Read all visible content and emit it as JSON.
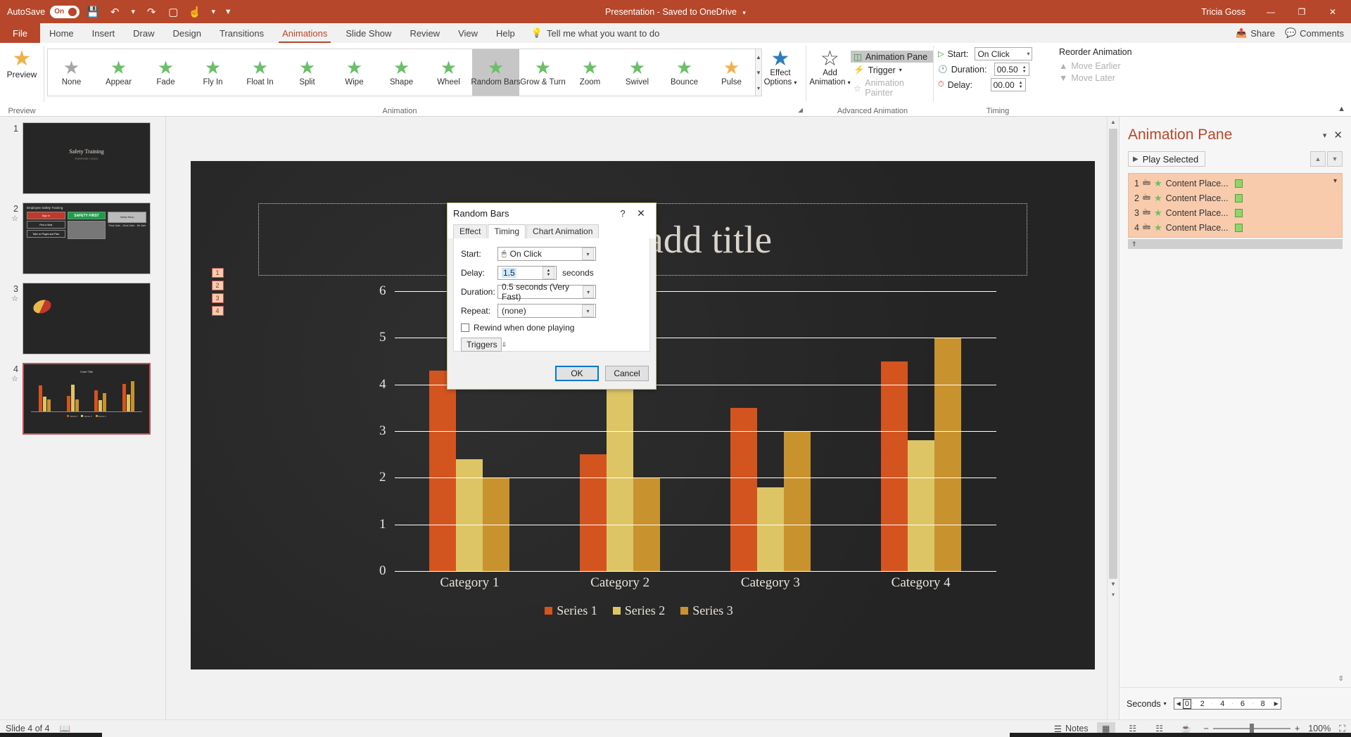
{
  "titlebar": {
    "autosave_label": "AutoSave",
    "autosave_state": "On",
    "icons": [
      "save-icon",
      "undo-icon",
      "redo-icon",
      "start-from-beginning-icon",
      "touch-mode-icon",
      "customize-toolbar-icon"
    ],
    "document_title": "Presentation  -  Saved to OneDrive",
    "user": "Tricia Goss",
    "minimize": "—",
    "restore": "❐",
    "close": "✕"
  },
  "ribbon_tabs": {
    "file": "File",
    "items": [
      "Home",
      "Insert",
      "Draw",
      "Design",
      "Transitions",
      "Animations",
      "Slide Show",
      "Review",
      "View",
      "Help"
    ],
    "active": "Animations",
    "tellme": "Tell me what you want to do",
    "share": "Share",
    "comments": "Comments"
  },
  "ribbon": {
    "preview": {
      "label": "Preview",
      "group": "Preview"
    },
    "animation": {
      "group": "Animation",
      "items": [
        {
          "label": "None",
          "selected": false,
          "color": "#a6a6a6"
        },
        {
          "label": "Appear",
          "selected": false,
          "color": "#6abf69"
        },
        {
          "label": "Fade",
          "selected": false,
          "color": "#6abf69"
        },
        {
          "label": "Fly In",
          "selected": false,
          "color": "#6abf69"
        },
        {
          "label": "Float In",
          "selected": false,
          "color": "#6abf69"
        },
        {
          "label": "Split",
          "selected": false,
          "color": "#6abf69"
        },
        {
          "label": "Wipe",
          "selected": false,
          "color": "#6abf69"
        },
        {
          "label": "Shape",
          "selected": false,
          "color": "#6abf69"
        },
        {
          "label": "Wheel",
          "selected": false,
          "color": "#6abf69"
        },
        {
          "label": "Random Bars",
          "selected": true,
          "color": "#6abf69"
        },
        {
          "label": "Grow & Turn",
          "selected": false,
          "color": "#6abf69"
        },
        {
          "label": "Zoom",
          "selected": false,
          "color": "#6abf69"
        },
        {
          "label": "Swivel",
          "selected": false,
          "color": "#6abf69"
        },
        {
          "label": "Bounce",
          "selected": false,
          "color": "#6abf69"
        },
        {
          "label": "Pulse",
          "selected": false,
          "color": "#f0b04a"
        }
      ]
    },
    "effect_options": {
      "line1": "Effect",
      "line2": "Options"
    },
    "advanced": {
      "group": "Advanced Animation",
      "add_animation_l1": "Add",
      "add_animation_l2": "Animation",
      "animation_pane": "Animation Pane",
      "trigger": "Trigger",
      "animation_painter": "Animation Painter"
    },
    "timing": {
      "group": "Timing",
      "start_label": "Start:",
      "start_value": "On Click",
      "duration_label": "Duration:",
      "duration_value": "00.50",
      "delay_label": "Delay:",
      "delay_value": "00.00",
      "reorder_title": "Reorder Animation",
      "move_earlier": "Move Earlier",
      "move_later": "Move Later"
    }
  },
  "thumbnails": [
    {
      "num": "1",
      "animated": false,
      "type": "title",
      "title": "Safety Training",
      "subtitle": "PURPOSE / ELEV"
    },
    {
      "num": "2",
      "animated": true,
      "type": "content",
      "header": "Employee Safety Training",
      "sign_in": "Sign In",
      "safety_first": "SAFETY FIRST",
      "find_exit": "Find a Seat",
      "take_pages": "Take on Pages and Plan",
      "caption1": "Safety Menu",
      "caption2": "Think Safe... Work Safe... Be Safe"
    },
    {
      "num": "3",
      "animated": true,
      "type": "shape"
    },
    {
      "num": "4",
      "animated": true,
      "type": "chart",
      "selected": true,
      "chart_title": "Chart Title"
    }
  ],
  "slide": {
    "title_placeholder": "Click to add title",
    "animation_tags": [
      "1",
      "2",
      "3",
      "4"
    ]
  },
  "chart_data": {
    "type": "bar",
    "title": "",
    "categories": [
      "Category 1",
      "Category 2",
      "Category 3",
      "Category 4"
    ],
    "series": [
      {
        "name": "Series 1",
        "color": "#d4541f",
        "values": [
          4.3,
          2.5,
          3.5,
          4.5
        ]
      },
      {
        "name": "Series 2",
        "color": "#ddc566",
        "values": [
          2.4,
          4.4,
          1.8,
          2.8
        ]
      },
      {
        "name": "Series 3",
        "color": "#c8922f",
        "values": [
          2.0,
          2.0,
          3.0,
          5.0
        ]
      }
    ],
    "yticks": [
      "0",
      "1",
      "2",
      "3",
      "4",
      "5",
      "6"
    ],
    "ylim": [
      0,
      6
    ],
    "xlabel": "",
    "ylabel": "",
    "grid": true,
    "legend_position": "bottom"
  },
  "animation_pane": {
    "title": "Animation Pane",
    "caret": "▾",
    "close": "✕",
    "play_selected": "Play Selected",
    "items": [
      {
        "index": "1",
        "name": "Content Place..."
      },
      {
        "index": "2",
        "name": "Content Place..."
      },
      {
        "index": "3",
        "name": "Content Place..."
      },
      {
        "index": "4",
        "name": "Content Place..."
      }
    ],
    "seconds_label": "Seconds",
    "timeline_ticks": [
      "0",
      "2",
      "4",
      "6",
      "8"
    ]
  },
  "dialog": {
    "title": "Random Bars",
    "help": "?",
    "close": "✕",
    "tabs": [
      {
        "label": "Effect",
        "active": false
      },
      {
        "label": "Timing",
        "active": true
      },
      {
        "label": "Chart Animation",
        "active": false
      }
    ],
    "start_label": "Start:",
    "start_value": "On Click",
    "delay_label": "Delay:",
    "delay_value": "1.5",
    "seconds_unit": "seconds",
    "duration_label": "Duration:",
    "duration_value": "0.5 seconds (Very Fast)",
    "repeat_label": "Repeat:",
    "repeat_value": "(none)",
    "rewind_label": "Rewind when done playing",
    "rewind_checked": false,
    "triggers_label": "Triggers",
    "ok": "OK",
    "cancel": "Cancel"
  },
  "statusbar": {
    "slide_counter": "Slide 4 of 4",
    "notes": "Notes",
    "zoom_level": "100%"
  }
}
